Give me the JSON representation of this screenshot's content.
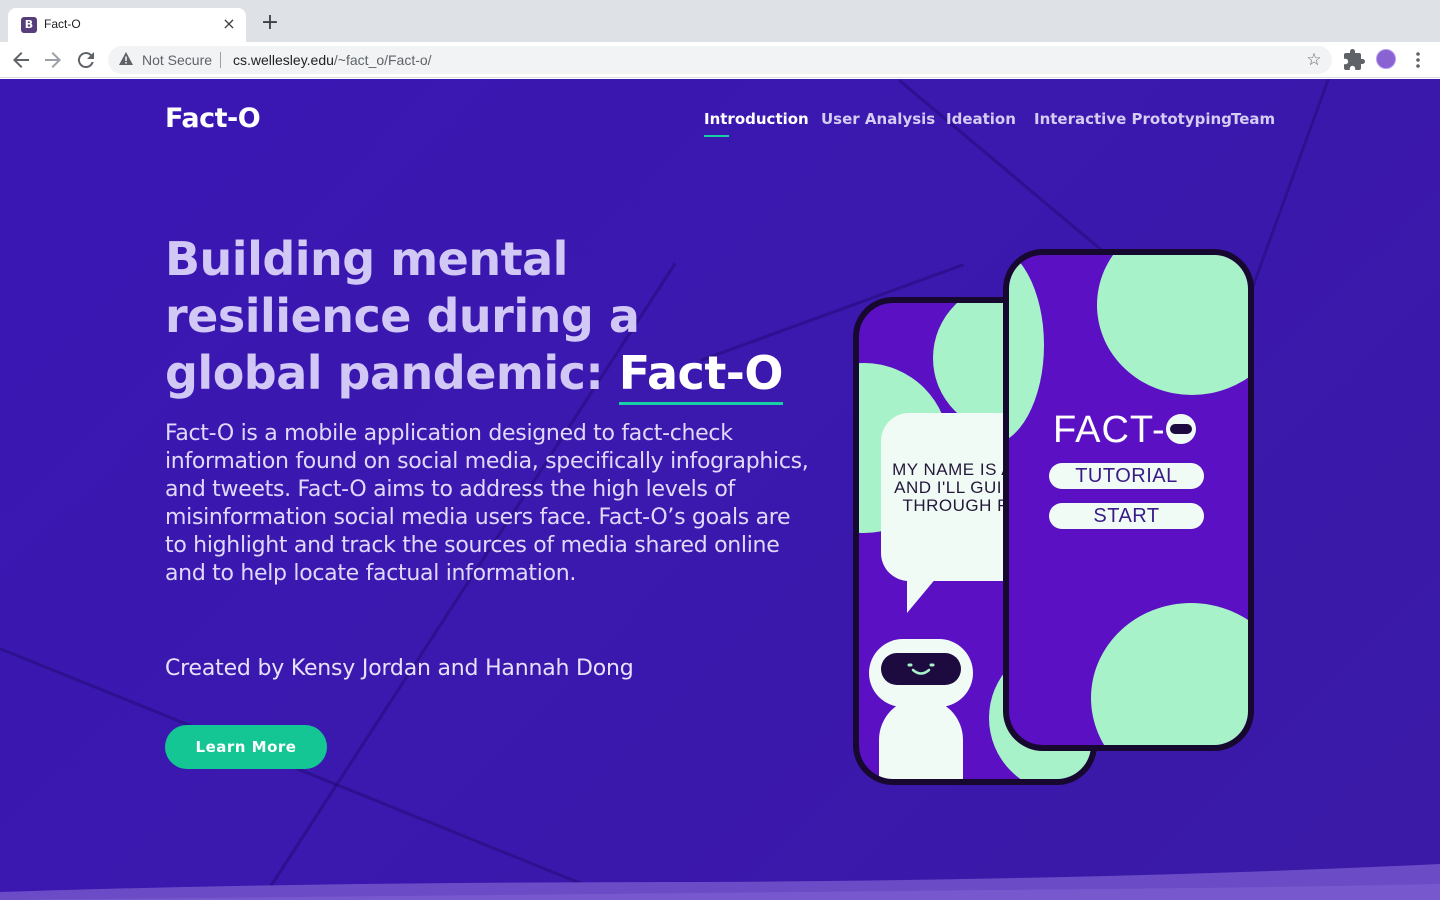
{
  "browser": {
    "tab_title": "Fact-O",
    "tab_favicon": "B",
    "tab_close": "×",
    "new_tab": "+",
    "security_label": "Not Secure",
    "url_host": "cs.wellesley.edu",
    "url_path": "/~fact_o/Fact-o/",
    "icons": [
      "back-icon",
      "forward-icon",
      "reload-icon",
      "warning-icon",
      "star-icon",
      "extensions-icon",
      "avatar-icon",
      "menu-icon"
    ]
  },
  "site": {
    "brand": "Fact-O",
    "nav": [
      {
        "label": "Introduction",
        "active": true
      },
      {
        "label": "User Analysis",
        "active": false
      },
      {
        "label": "Ideation",
        "active": false
      },
      {
        "label": "Interactive Prototyping",
        "active": false
      },
      {
        "label": "Team",
        "active": false
      }
    ]
  },
  "hero": {
    "headline_line1": "Building mental",
    "headline_line2": "resilience during a",
    "headline_line3": "global pandemic: ",
    "headline_highlight": "Fact-O",
    "description": "Fact-O is a mobile application designed to fact-check information found on social media, specifically infographics, and tweets. Fact-O aims to address the high levels of misinformation social media users face. Fact-O’s goals are to highlight and track the sources of media shared online and to help locate factual information.",
    "credit": "Created by Kensy Jordan and Hannah Dong",
    "cta_label": "Learn More"
  },
  "illustration": {
    "speech_text": "MY NAME IS ATHENA AND I'LL GUIDE YOU THROUGH FACT-O",
    "app_title": "FACT-",
    "tutorial_label": "TUTORIAL",
    "start_label": "START"
  },
  "colors": {
    "background": "#3a17b3",
    "accent": "#18d0a3",
    "button": "#14c694",
    "phone_screen": "#5b10c4",
    "mint": "#a8f2c9"
  }
}
